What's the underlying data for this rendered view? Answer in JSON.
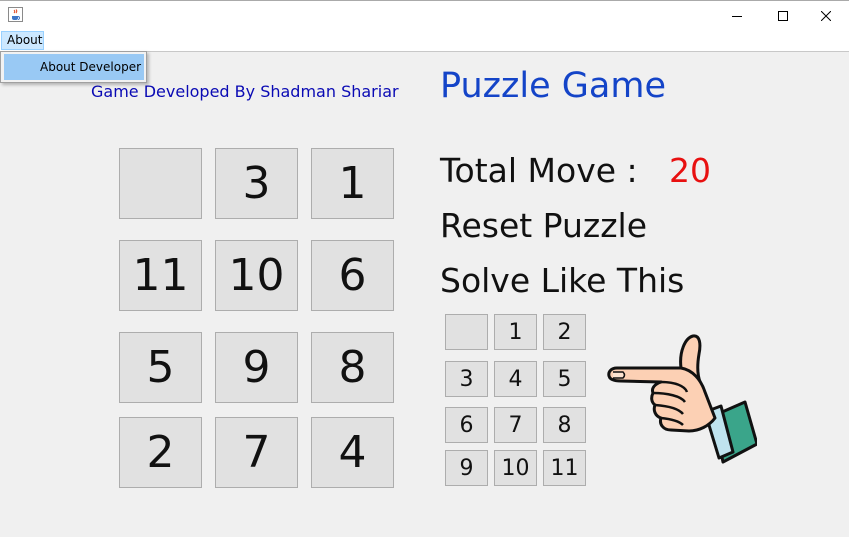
{
  "window": {
    "controls": {
      "minimize_icon": "minimize-icon",
      "maximize_icon": "maximize-icon",
      "close_icon": "close-icon"
    }
  },
  "menu": {
    "about_label": "About",
    "dropdown": {
      "about_developer_label": "About Developer"
    }
  },
  "header": {
    "credit": "Game Developed By Shadman Shariar",
    "title": "Puzzle Game"
  },
  "board": {
    "tiles": [
      "",
      "3",
      "1",
      "11",
      "10",
      "6",
      "5",
      "9",
      "8",
      "2",
      "7",
      "4"
    ]
  },
  "stats": {
    "total_move_label": "Total Move :",
    "total_move_value": "20"
  },
  "actions": {
    "reset_label": "Reset Puzzle",
    "solve_label": "Solve Like This"
  },
  "solution": {
    "tiles": [
      "",
      "1",
      "2",
      "3",
      "4",
      "5",
      "6",
      "7",
      "8",
      "9",
      "10",
      "11"
    ]
  },
  "colors": {
    "title": "#1444c8",
    "credit": "#0a0ab4",
    "move_value": "#e81010",
    "menu_highlight": "#99c9f4"
  },
  "icons": {
    "pointer": "pointing-hand-icon",
    "app": "java-cup-icon"
  }
}
